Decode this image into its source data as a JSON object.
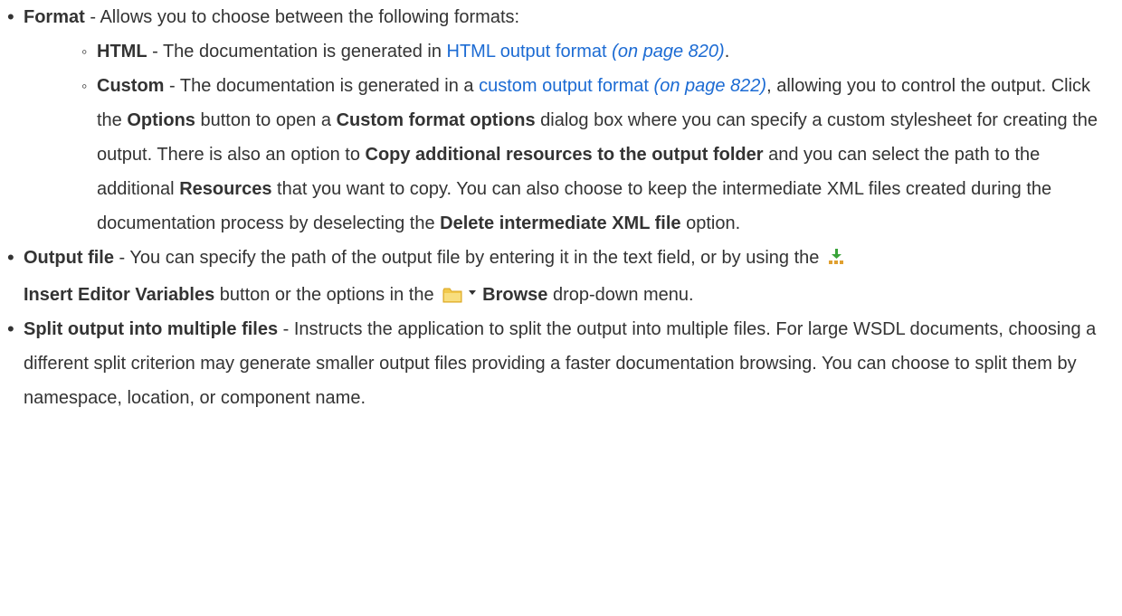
{
  "items": [
    {
      "term": "Format",
      "desc": " - Allows you to choose between the following formats:",
      "sub": [
        {
          "term": "HTML",
          "pre": " - The documentation is generated in ",
          "link": "HTML output format",
          "pageref": "(on page 820)",
          "post": "."
        },
        {
          "term": "Custom",
          "pre": " - The documentation is generated in a ",
          "link": "custom output format",
          "pageref": "(on page 822)",
          "post_1": ", allowing you to control the output. Click the ",
          "options_label": "Options",
          "post_2": " button to open a ",
          "dialog_label": "Custom format options",
          "post_3": " dialog box where you can specify a custom stylesheet for creating the output. There is also an option to ",
          "copy_label": "Copy additional resources to the output folder",
          "post_4": " and you can select the path to the additional ",
          "resources_label": "Resources",
          "post_5": " that you want to copy. You can also choose to keep the intermediate XML files created during the documentation process by deselecting the ",
          "delete_label": "Delete intermediate XML file",
          "post_6": " option."
        }
      ]
    },
    {
      "term": "Output file",
      "desc_1": " - You can specify the path of the output file by entering it in the text field, or by using the ",
      "insert_label": "Insert Editor Variables",
      "desc_2": " button or the options in the ",
      "browse_label": "Browse",
      "desc_3": " drop-down menu."
    },
    {
      "term": "Split output into multiple files",
      "desc": " - Instructs the application to split the output into multiple files. For large WSDL documents, choosing a different split criterion may generate smaller output files providing a faster documentation browsing. You can choose to split them by namespace, location, or component name."
    }
  ],
  "icons": {
    "insert": "insert-editor-variables-icon",
    "folder": "folder-icon",
    "caret": "dropdown-caret-icon"
  },
  "colors": {
    "text": "#333333",
    "link": "#1c6bd3",
    "folder": "#f2c94c",
    "insert_arrow": "#3aa33a"
  }
}
